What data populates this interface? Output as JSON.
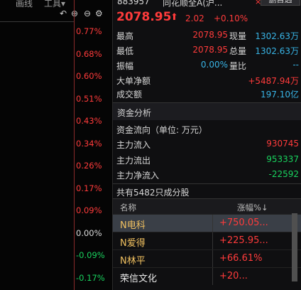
{
  "toolbar": {
    "draw_line": "画线",
    "tools": "工具▾"
  },
  "axis_ticks": [
    {
      "label": "0.77%",
      "dir": "up"
    },
    {
      "label": "0.68%",
      "dir": "up"
    },
    {
      "label": "0.60%",
      "dir": "up"
    },
    {
      "label": "0.51%",
      "dir": "up"
    },
    {
      "label": "0.43%",
      "dir": "up"
    },
    {
      "label": "0.34%",
      "dir": "up"
    },
    {
      "label": "0.26%",
      "dir": "up"
    },
    {
      "label": "0.17%",
      "dir": "up"
    },
    {
      "label": "0.09%",
      "dir": "up"
    },
    {
      "label": "0.00%",
      "dir": "flat"
    },
    {
      "label": "-0.09%",
      "dir": "down"
    },
    {
      "label": "-0.17%",
      "dir": "down"
    }
  ],
  "stock": {
    "code": "883957",
    "name": "同花顺全A(沪...",
    "close": "×",
    "self_select": "删自选",
    "price": "2078.95",
    "change": "2.02",
    "change_pct": "+0.10%"
  },
  "quote": {
    "high_label": "最高",
    "high": "2078.95",
    "volume_now_label": "现量",
    "volume_now": "1302.63万",
    "low_label": "最低",
    "low": "2078.95",
    "total_volume_label": "总量",
    "total_volume": "1302.63万",
    "amplitude_label": "振幅",
    "amplitude": "0.00%",
    "volume_ratio_label": "量比",
    "volume_ratio": "--",
    "big_order_label": "大单净额",
    "big_order": "+5487.94万",
    "turnover_label": "成交额",
    "turnover": "197.10亿"
  },
  "capital": {
    "title": "资金分析",
    "flow_label": "资金流向（单位: 万元）",
    "main_in_label": "主力流入",
    "main_in": "930745",
    "main_out_label": "主力流出",
    "main_out": "953337",
    "main_net_label": "主力净流入",
    "main_net": "-22592"
  },
  "components": {
    "summary": "共有5482只成分股",
    "col_name": "名称",
    "col_change": "涨幅%↓",
    "rows": [
      {
        "name": "N电科",
        "pct": "+750.05..."
      },
      {
        "name": "N爱得",
        "pct": "+225.95..."
      },
      {
        "name": "N林平",
        "pct": "+66.61%"
      },
      {
        "name": "荣信文化",
        "pct": "+20..."
      }
    ]
  }
}
